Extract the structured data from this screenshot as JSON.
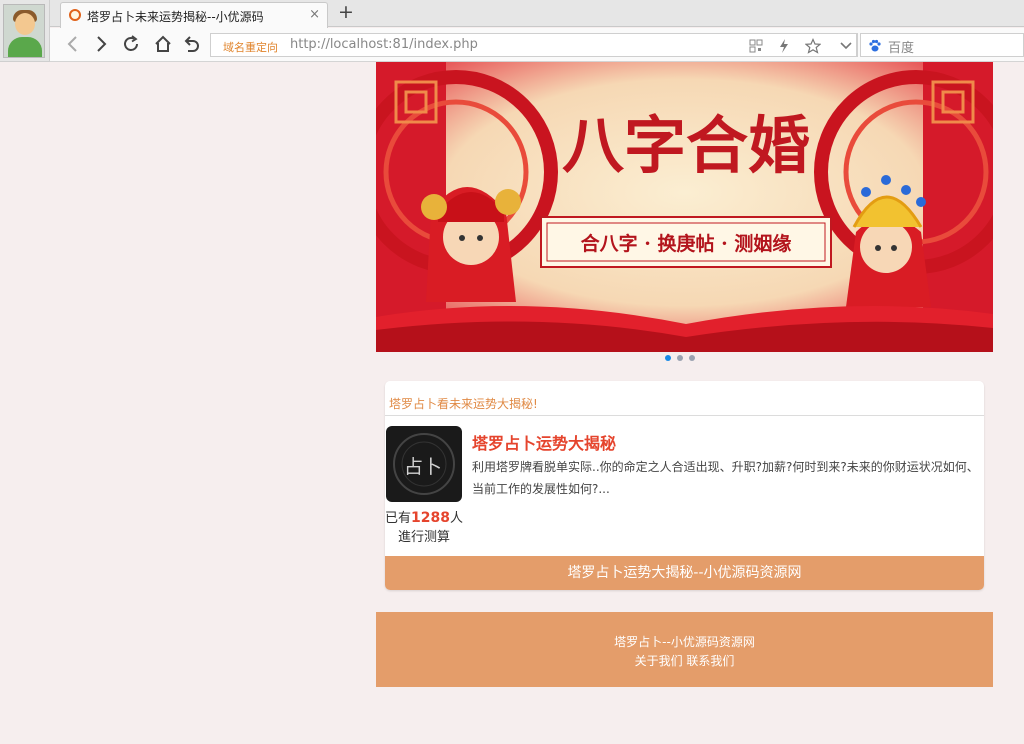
{
  "browser": {
    "tab_title": "塔罗占卜未来运势揭秘--小优源码",
    "tab_close": "×",
    "new_tab": "+",
    "redirect_label": "域名重定向",
    "url": "http://localhost:81/index.php",
    "search_engine": "百度"
  },
  "banner": {
    "title": "八字合婚",
    "subtitle": "合八字 · 换庚帖 · 测姻缘",
    "slide_count": 3,
    "active_slide": 1
  },
  "card": {
    "header": "塔罗占卜看未来运势大揭秘!",
    "thumb_glyph": "占卜",
    "title": "塔罗占卜运势大揭秘",
    "description": "利用塔罗牌看脱单实际..你的命定之人合适出现、升职?加薪?何时到来?未来的你财运状况如何、当前工作的发展性如何?...",
    "count_prefix": "已有",
    "count_value": "1288",
    "count_suffix": "人",
    "count_line2": "進行测算",
    "button": "塔罗占卜运势大揭秘--小优源码资源网"
  },
  "footer": {
    "line1": "塔罗占卜--小优源码资源网",
    "about": "关于我们",
    "contact": "联系我们"
  },
  "colors": {
    "page_bg": "#f6eeee",
    "accent": "#e49d6a",
    "title_red": "#e5442d"
  }
}
